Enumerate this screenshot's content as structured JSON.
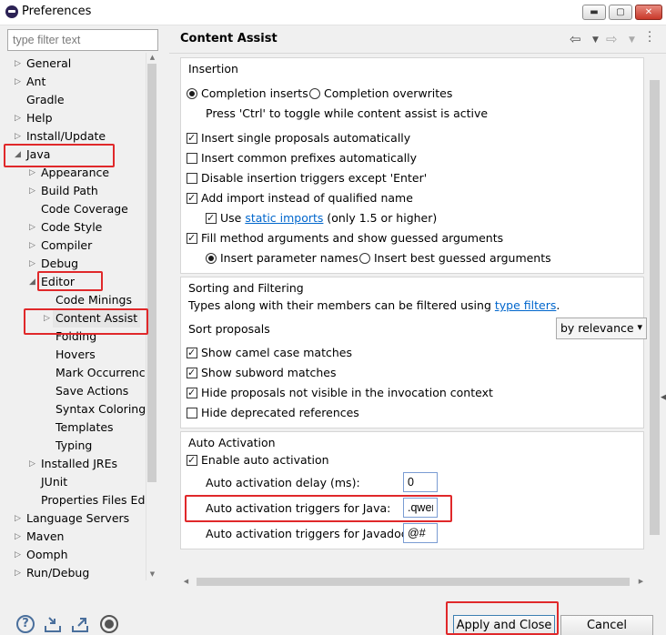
{
  "window": {
    "title": "Preferences",
    "minimize": "▬",
    "maximize": "▢",
    "close": "✕"
  },
  "filter": {
    "placeholder": "type filter text"
  },
  "tree": {
    "general": "General",
    "ant": "Ant",
    "gradle": "Gradle",
    "help": "Help",
    "install_update": "Install/Update",
    "java": "Java",
    "appearance": "Appearance",
    "build_path": "Build Path",
    "code_coverage": "Code Coverage",
    "code_style": "Code Style",
    "compiler": "Compiler",
    "debug": "Debug",
    "editor": "Editor",
    "code_minings": "Code Minings",
    "content_assist": "Content Assist",
    "folding": "Folding",
    "hovers": "Hovers",
    "mark_occurrences": "Mark Occurrences",
    "save_actions": "Save Actions",
    "syntax_coloring": "Syntax Coloring",
    "templates": "Templates",
    "typing": "Typing",
    "installed_jres": "Installed JREs",
    "junit": "JUnit",
    "properties_files_editor": "Properties Files Editor",
    "language_servers": "Language Servers",
    "maven": "Maven",
    "oomph": "Oomph",
    "run_debug": "Run/Debug"
  },
  "pane": {
    "title": "Content Assist",
    "insertion": {
      "legend": "Insertion",
      "completion_inserts": "Completion inserts",
      "completion_overwrites": "Completion overwrites",
      "toggle_hint": "Press 'Ctrl' to toggle while content assist is active",
      "insert_single": "Insert single proposals automatically",
      "insert_common": "Insert common prefixes automatically",
      "disable_triggers": "Disable insertion triggers except 'Enter'",
      "add_import": "Add import instead of qualified name",
      "use": "Use",
      "static_imports": "static imports",
      "static_imports_suffix": "(only 1.5 or higher)",
      "fill_method_args": "Fill method arguments and show guessed arguments",
      "insert_param_names": "Insert parameter names",
      "insert_best_guessed": "Insert best guessed arguments"
    },
    "sorting": {
      "legend": "Sorting and Filtering",
      "types_text": "Types along with their members can be filtered using",
      "type_filters": "type filters",
      "period": ".",
      "sort_proposals": "Sort proposals",
      "sort_value": "by relevance",
      "camel_case": "Show camel case matches",
      "subword": "Show subword matches",
      "hide_not_visible": "Hide proposals not visible in the invocation context",
      "hide_deprecated": "Hide deprecated references"
    },
    "auto": {
      "legend": "Auto Activation",
      "enable": "Enable auto activation",
      "delay_label": "Auto activation delay (ms):",
      "delay_value": "0",
      "java_label": "Auto activation triggers for Java:",
      "java_value": ".qwer",
      "javadoc_label": "Auto activation triggers for Javadoc:",
      "javadoc_value": "@#"
    }
  },
  "footer": {
    "help": "?",
    "apply_close": "Apply and Close",
    "cancel": "Cancel"
  }
}
